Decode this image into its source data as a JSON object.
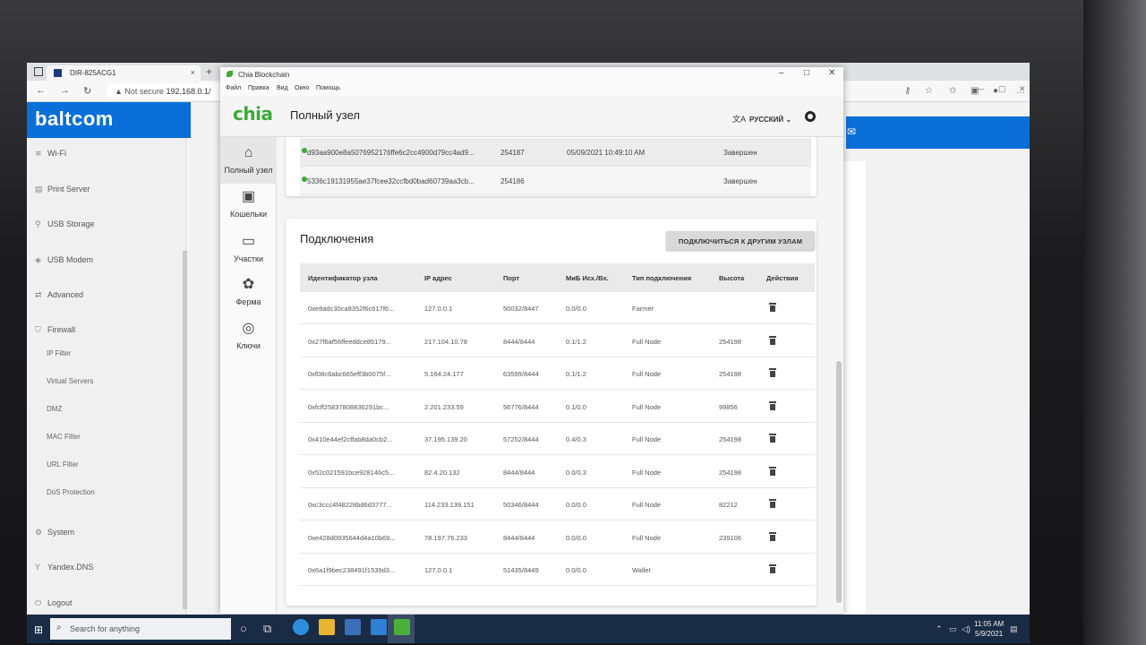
{
  "browser": {
    "tab_title": "DIR-825ACG1",
    "address_security": "Not secure",
    "address_url": "192.168.0.1/",
    "nav_icons": [
      "back-arrow-icon",
      "forward-arrow-icon",
      "reload-icon"
    ],
    "toolbar_icons": [
      "key-icon",
      "favorite-star-icon",
      "collections-icon",
      "reading-list-icon",
      "profile-icon",
      "more-icon"
    ]
  },
  "router": {
    "logo": "baltcom",
    "sidebar": [
      {
        "label": "Wi-Fi",
        "icon": "wifi-icon"
      },
      {
        "label": "Print Server",
        "icon": "printer-icon"
      },
      {
        "label": "USB Storage",
        "icon": "usb-icon"
      },
      {
        "label": "USB Modem",
        "icon": "modem-icon"
      },
      {
        "label": "Advanced",
        "icon": "arrows-icon"
      },
      {
        "label": "Firewall",
        "icon": "shield-icon"
      },
      {
        "label": "System",
        "icon": "gear-icon"
      },
      {
        "label": "Yandex.DNS",
        "icon": "dns-icon"
      },
      {
        "label": "Logout",
        "icon": "logout-icon"
      }
    ],
    "firewall_sub": [
      "IP Filter",
      "Virtual Servers",
      "DMZ",
      "MAC Filter",
      "URL Filter",
      "DoS Protection"
    ]
  },
  "chia": {
    "window_title": "Chia Blockchain",
    "menu": [
      "Файл",
      "Правка",
      "Вид",
      "Окно",
      "Помощь"
    ],
    "logo": "chia",
    "page_title": "Полный узел",
    "language": "РУССКИЙ",
    "nav": [
      {
        "label": "Полный узел",
        "icon": "home-icon"
      },
      {
        "label": "Кошельки",
        "icon": "wallet-icon"
      },
      {
        "label": "Участки",
        "icon": "storage-icon"
      },
      {
        "label": "Ферма",
        "icon": "plant-icon"
      },
      {
        "label": "Ключи",
        "icon": "lifebuoy-icon"
      }
    ],
    "blocks": [
      {
        "hash": "d93aa900e8a5076952176ffe6c2cc4900d79cc4ad9...",
        "height": "254187",
        "time": "05/09/2021 10:49:10 AM",
        "state": "Завершен"
      },
      {
        "hash": "5336c19131955ae37fcee32ccfbd0bad60739aa3cb...",
        "height": "254186",
        "time": "",
        "state": "Завершен"
      }
    ],
    "connections": {
      "title": "Подключения",
      "connect_button": "ПОДКЛЮЧИТЬСЯ К ДРУГИМ УЗЛАМ",
      "columns": [
        "Идентификатор узла",
        "IP адрес",
        "Порт",
        "МиБ Исх./Вх.",
        "Тип подключения",
        "Высота",
        "Действия"
      ],
      "rows": [
        {
          "id": "0xe8adc30ca8352f6c617f6...",
          "ip": "127.0.0.1",
          "port": "50032/8447",
          "mib": "0.0/0.0",
          "type": "Farmer",
          "height": ""
        },
        {
          "id": "0x27f6af56ffeeddce85179...",
          "ip": "217.104.10.78",
          "port": "8444/8444",
          "mib": "0.1/1.2",
          "type": "Full Node",
          "height": "254198"
        },
        {
          "id": "0xf08c6abc665eff3b0075f...",
          "ip": "5.164.24.177",
          "port": "63599/8444",
          "mib": "0.1/1.2",
          "type": "Full Node",
          "height": "254198"
        },
        {
          "id": "0xfcff25837808836291bc...",
          "ip": "2.201.233.59",
          "port": "56776/8444",
          "mib": "0.1/0.0",
          "type": "Full Node",
          "height": "99856"
        },
        {
          "id": "0x410e44ef2cffab8da0cb2...",
          "ip": "37.195.139.20",
          "port": "57252/8444",
          "mib": "0.4/0.3",
          "type": "Full Node",
          "height": "254198"
        },
        {
          "id": "0x52c021591bce928146c5...",
          "ip": "82.4.20.132",
          "port": "8444/8444",
          "mib": "0.0/0.3",
          "type": "Full Node",
          "height": "254198"
        },
        {
          "id": "0xc3ccc4f48228bd6d3777...",
          "ip": "114.233.139.151",
          "port": "50346/8444",
          "mib": "0.0/0.0",
          "type": "Full Node",
          "height": "82212"
        },
        {
          "id": "0xe428d0935644d4a10b69...",
          "ip": "78.197.76.233",
          "port": "8444/8444",
          "mib": "0.0/0.0",
          "type": "Full Node",
          "height": "239106"
        },
        {
          "id": "0x6a1f9bec238491f1539d3...",
          "ip": "127.0.0.1",
          "port": "51435/8449",
          "mib": "0.0/0.0",
          "type": "Wallet",
          "height": ""
        }
      ]
    }
  },
  "taskbar": {
    "search_placeholder": "Search for anything",
    "clock_time": "11:05 AM",
    "clock_date": "5/9/2021",
    "apps": [
      "edge-icon",
      "file-explorer-icon",
      "store-icon",
      "mail-icon",
      "chia-app-icon"
    ]
  }
}
